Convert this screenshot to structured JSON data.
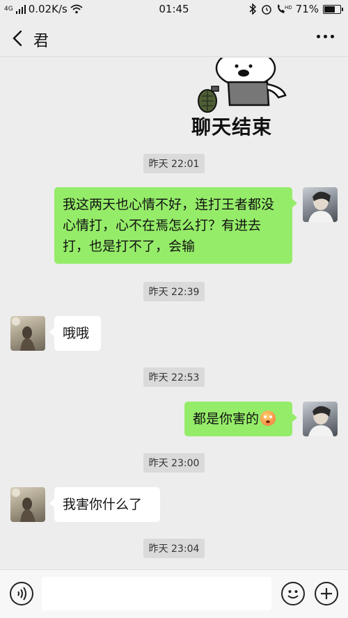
{
  "status_bar": {
    "network": "4G",
    "speed": "0.02K/s",
    "time": "01:45",
    "battery": "71%",
    "battery_level": 0.71
  },
  "nav": {
    "title": "君"
  },
  "sticker": {
    "text": "聊天结束"
  },
  "messages": [
    {
      "type": "time",
      "text": "昨天 22:01"
    },
    {
      "type": "sent",
      "text": "我这两天也心情不好，连打王者都没心情打，心不在焉怎么打？有进去打，也是打不了，会输"
    },
    {
      "type": "time",
      "text": "昨天 22:39"
    },
    {
      "type": "received",
      "text": "哦哦"
    },
    {
      "type": "time",
      "text": "昨天 22:53"
    },
    {
      "type": "sent",
      "text": "都是你害的",
      "emoji": "flushed-face"
    },
    {
      "type": "time",
      "text": "昨天 23:00"
    },
    {
      "type": "received",
      "text": "我害你什么了"
    },
    {
      "type": "time",
      "text": "昨天 23:04"
    }
  ],
  "input": {
    "value": "",
    "placeholder": ""
  },
  "colors": {
    "sent_bubble": "#95ec69",
    "received_bubble": "#ffffff",
    "background": "#ededed"
  }
}
